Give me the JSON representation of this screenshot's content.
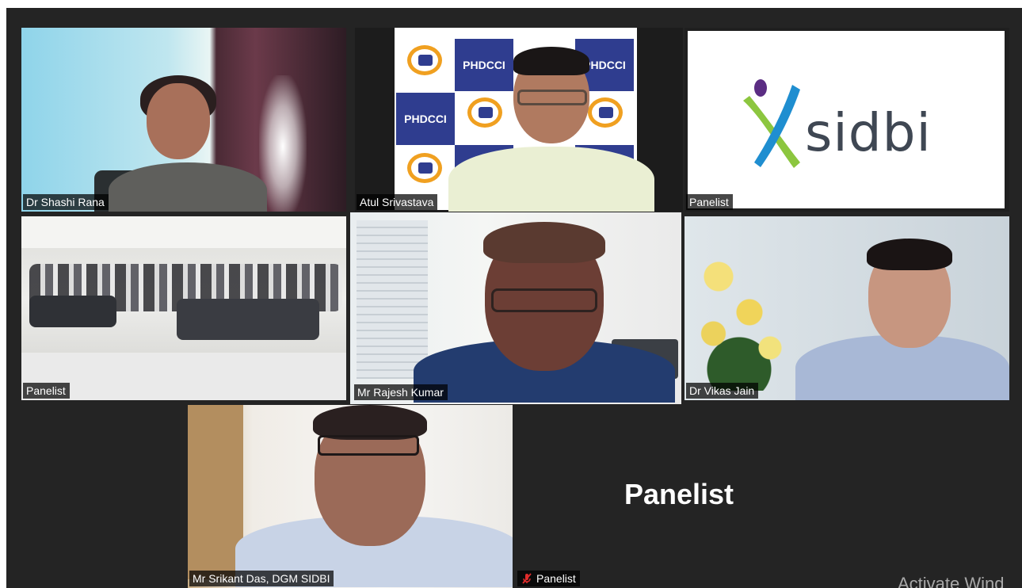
{
  "app": "Zoom meeting gallery view",
  "tiles": [
    {
      "id": "tile-1",
      "name": "Dr Shashi Rana",
      "video": true,
      "muted": false,
      "active_speaker": false
    },
    {
      "id": "tile-2",
      "name": "Atul Srivastava",
      "video": true,
      "muted": false,
      "active_speaker": false,
      "backdrop_text": "PHDCCI"
    },
    {
      "id": "tile-3",
      "name": "Panelist",
      "video": true,
      "muted": false,
      "active_speaker": false,
      "logo_text": "sidbi"
    },
    {
      "id": "tile-4",
      "name": "Panelist",
      "video": true,
      "muted": false,
      "active_speaker": false
    },
    {
      "id": "tile-5",
      "name": "Mr Rajesh Kumar",
      "video": true,
      "muted": false,
      "active_speaker": true
    },
    {
      "id": "tile-6",
      "name": "Dr Vikas Jain",
      "video": true,
      "muted": false,
      "active_speaker": false
    },
    {
      "id": "tile-7",
      "name": "Mr Srikant Das, DGM SIDBI",
      "video": true,
      "muted": false,
      "active_speaker": false
    },
    {
      "id": "tile-8",
      "name": "Panelist",
      "video": false,
      "muted": true,
      "active_speaker": false,
      "center_name": "Panelist"
    }
  ],
  "watermark": "Activate Wind",
  "colors": {
    "stage_bg": "#242424",
    "active_speaker_border": "#e7e8a0",
    "muted_icon": "#e02b2b",
    "sidbi_green": "#8cc63f",
    "sidbi_blue": "#1f8ed0",
    "sidbi_purple": "#5b2d83",
    "phdcci_blue": "#2f3d8f",
    "phdcci_gold": "#f0a020"
  }
}
